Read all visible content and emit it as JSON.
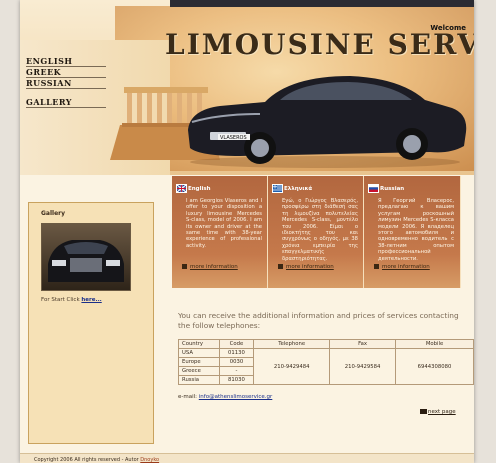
{
  "header": {
    "welcome": "Welcome",
    "title": "LIMOUSINE SERVICE",
    "plate": "VLASEROS"
  },
  "nav": {
    "languages": [
      "ENGLISH",
      "GREEK",
      "RUSSIAN"
    ],
    "gallery": "GALLERY"
  },
  "sidebar": {
    "gallery_title": "Gallery",
    "start_text": "For Start Click",
    "start_link": "here..."
  },
  "boxes": [
    {
      "language": "English",
      "text": "I am Georgios Vlaseros and I offer to your disposition a luxury limousine Mercedes S-class, model of 2006. I am its owner and driver at the same time with 38-year experience of professional activity.",
      "more": "more information"
    },
    {
      "language": "Ελληνικά",
      "text": "Εγώ, ο Γιώργος Βλασερός, προσφέρω στη διάθεσή σας τη λιμουζίνα πολυτελείας Mercedes S-class, μοντέλο του 2006. Είμαι ο ιδιοκτήτης του και συγχρόνως ο οδηγός, με 38 χρόνια εμπειρία της επαγγελματικής δραστηριότητας.",
      "more": "more information"
    },
    {
      "language": "Russian",
      "text": "Я Георгий Власерос, предлагаю к вашим услугам роскошный лимузин Mercedes S-класса модели 2006. Я владелец этого автомобиля и одновременно водитель с 38-летним опытом профессиональной деятельности.",
      "more": "more information"
    }
  ],
  "contact": {
    "intro": "You can receive the additional information and prices of services contacting the follow telephones:",
    "headers": [
      "Country",
      "Code",
      "Telephone",
      "Fax",
      "Mobile"
    ],
    "rows": [
      {
        "country": "USA",
        "code": "01130"
      },
      {
        "country": "Europe",
        "code": "0030"
      },
      {
        "country": "Greece",
        "code": "-"
      },
      {
        "country": "Russia",
        "code": "81030"
      }
    ],
    "telephone": "210-9429484",
    "fax": "210-9429584",
    "mobile": "6944308080",
    "email_label": "e-mail:",
    "email": "info@athenslimoservice.gr",
    "next": "next page"
  },
  "footer": {
    "copyright": "Copyright 2006 All rights reserved - Autor",
    "author": "Dnoyko"
  },
  "colors": {
    "box": "#c5794b",
    "link": "#1a2f8a",
    "page": "#fbf3e2"
  }
}
